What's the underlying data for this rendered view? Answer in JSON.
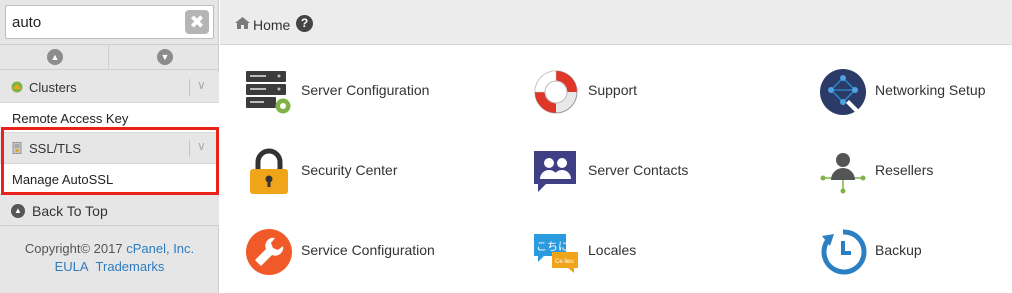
{
  "search": {
    "value": "auto",
    "placeholder": "",
    "clear_glyph": "✖"
  },
  "sidebar": {
    "groups": [
      {
        "label": "Clusters",
        "items": [
          {
            "label": "Remote Access Key"
          }
        ]
      },
      {
        "label": "SSL/TLS",
        "items": [
          {
            "label": "Manage AutoSSL"
          }
        ]
      }
    ],
    "back_to_top": "Back To Top"
  },
  "footer": {
    "copyright": "Copyright© 2017",
    "brand": "cPanel, Inc.",
    "eula": "EULA",
    "trademarks": "Trademarks"
  },
  "topbar": {
    "home": "Home",
    "help": "?"
  },
  "tiles": [
    {
      "label": "Server Configuration",
      "icon": "server-config-icon"
    },
    {
      "label": "Support",
      "icon": "lifebuoy-icon"
    },
    {
      "label": "Networking Setup",
      "icon": "network-icon"
    },
    {
      "label": "Security Center",
      "icon": "lock-icon"
    },
    {
      "label": "Server Contacts",
      "icon": "contacts-icon"
    },
    {
      "label": "Resellers",
      "icon": "resellers-icon"
    },
    {
      "label": "Service Configuration",
      "icon": "wrench-icon"
    },
    {
      "label": "Locales",
      "icon": "locales-icon"
    },
    {
      "label": "Backup",
      "icon": "backup-icon"
    }
  ],
  "locales_icon_text": {
    "primary": "こちに",
    "secondary": "Ce lieu"
  },
  "colors": {
    "highlight": "#e8231b",
    "link": "#2d7cc1",
    "lock": "#f0a419",
    "orange": "#f05a28",
    "blue": "#2b7fc3",
    "navy": "#2b3a66"
  }
}
